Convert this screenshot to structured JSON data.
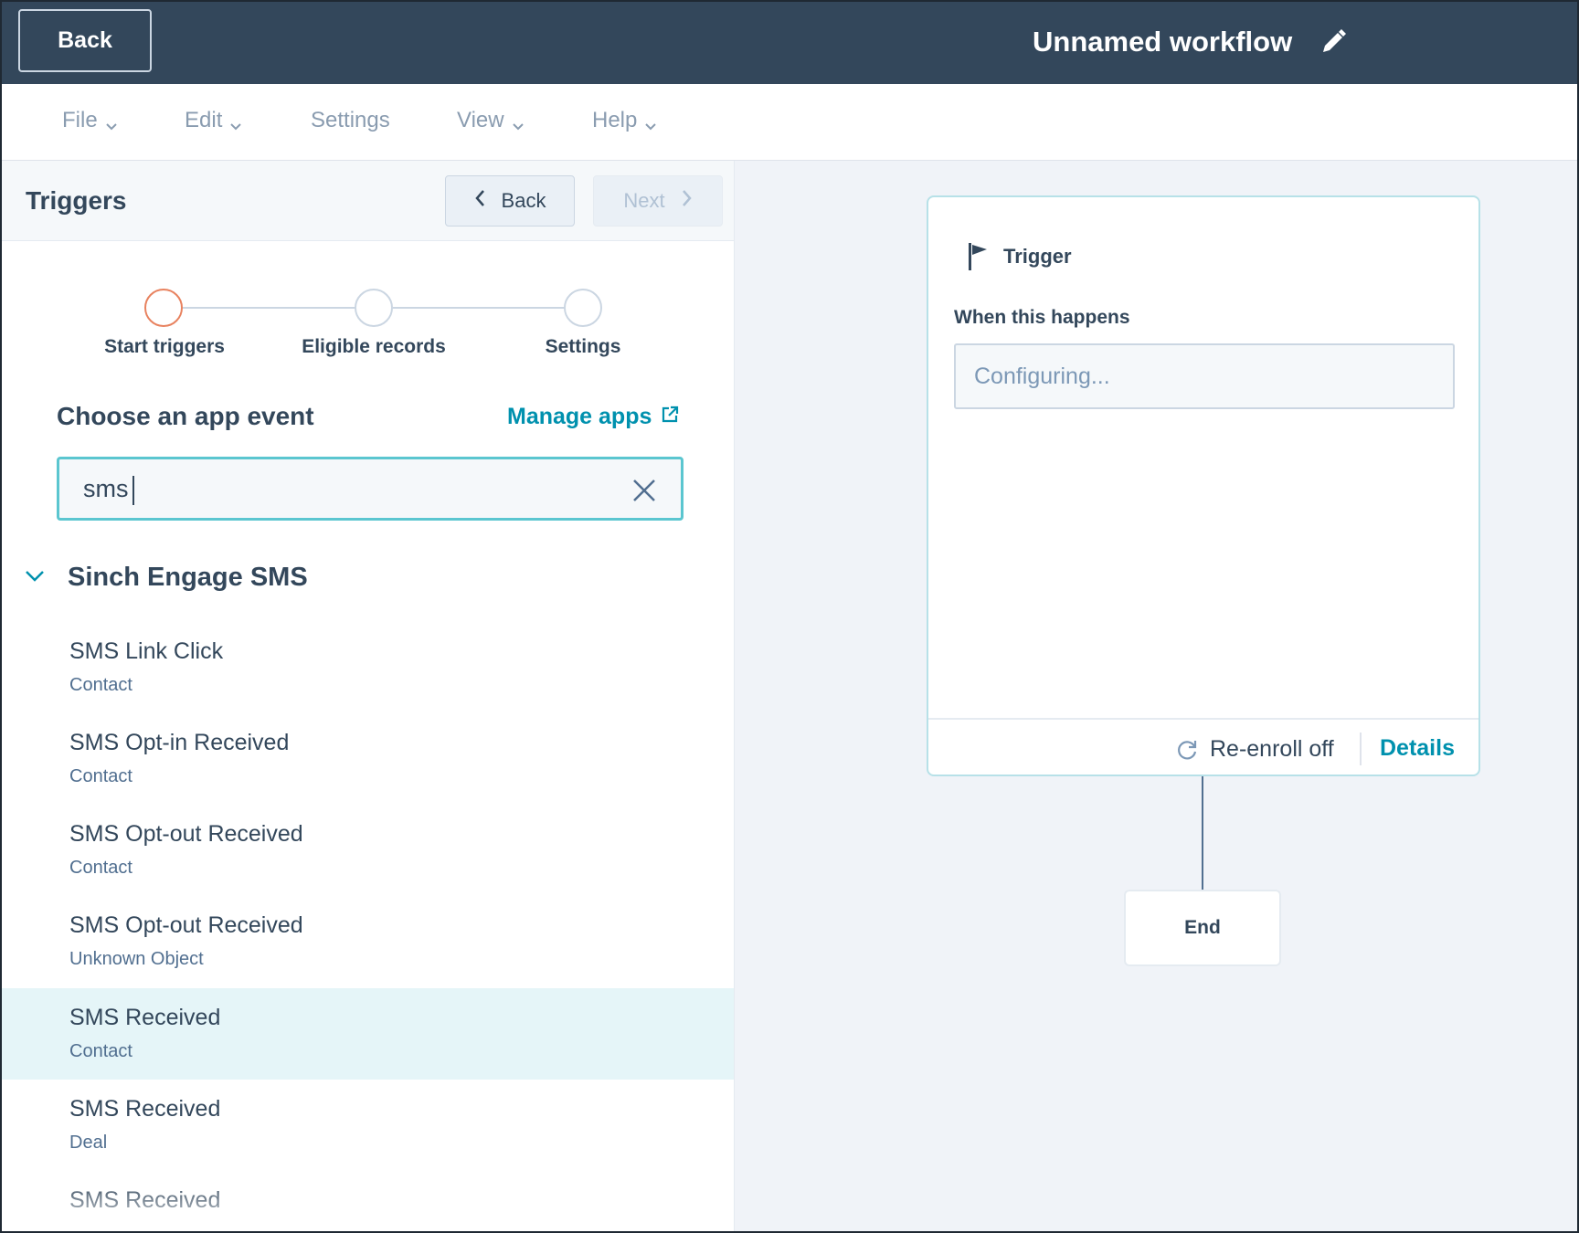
{
  "header": {
    "back_label": "Back",
    "workflow_title": "Unnamed workflow"
  },
  "menu": {
    "file": "File",
    "edit": "Edit",
    "settings": "Settings",
    "view": "View",
    "help": "Help"
  },
  "panel": {
    "title": "Triggers",
    "back_label": "Back",
    "next_label": "Next",
    "steps": [
      "Start triggers",
      "Eligible records",
      "Settings"
    ],
    "choose_label": "Choose an app event",
    "manage_label": "Manage apps",
    "search_value": "sms",
    "group_title": "Sinch Engage SMS",
    "events": [
      {
        "name": "SMS Link Click",
        "object": "Contact"
      },
      {
        "name": "SMS Opt-in Received",
        "object": "Contact"
      },
      {
        "name": "SMS Opt-out Received",
        "object": "Contact"
      },
      {
        "name": "SMS Opt-out Received",
        "object": "Unknown Object"
      },
      {
        "name": "SMS Received",
        "object": "Contact"
      },
      {
        "name": "SMS Received",
        "object": "Deal"
      },
      {
        "name": "SMS Received",
        "object": ""
      }
    ]
  },
  "canvas": {
    "trigger_title": "Trigger",
    "when_label": "When this happens",
    "config_text": "Configuring...",
    "reenroll_label": "Re-enroll off",
    "details_label": "Details",
    "end_label": "End"
  },
  "colors": {
    "header_bg": "#33475b",
    "accent": "#0091ae",
    "active_step": "#e8825f",
    "selected_row": "#e5f5f8"
  }
}
